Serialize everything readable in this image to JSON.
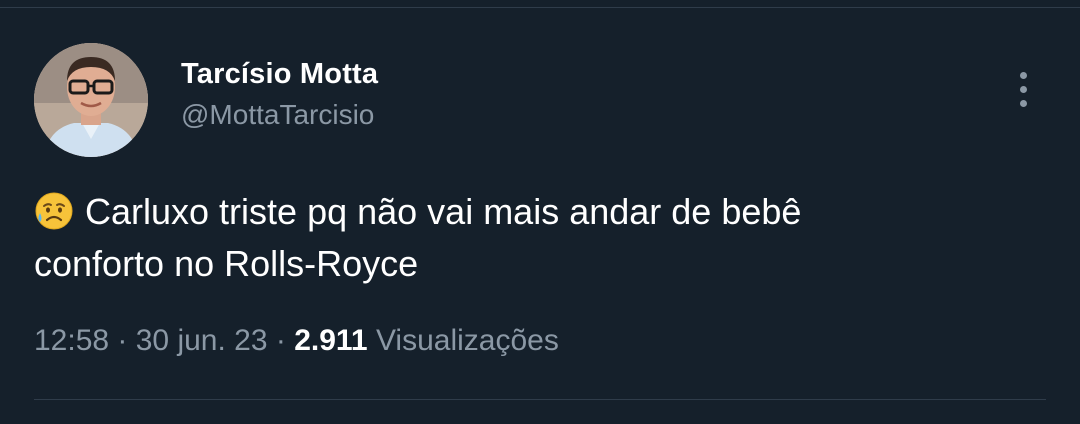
{
  "author": {
    "display_name": "Tarcísio Motta",
    "handle": "@MottaTarcisio",
    "avatar_icon": "profile-photo"
  },
  "menu": {
    "icon": "more-vertical-icon"
  },
  "tweet": {
    "emoji": "sad-relieved-face-emoji",
    "text_line_1": "Carluxo triste pq não vai mais andar de bebê",
    "text_line_2": "conforto no Rolls-Royce"
  },
  "meta": {
    "time": "12:58",
    "separator": " · ",
    "date": "30 jun. 23",
    "views_count": "2.911",
    "views_label": "Visualizações"
  },
  "colors": {
    "background": "#15202b",
    "primary_text": "#ffffff",
    "secondary_text": "#8b98a5",
    "divider": "#2f3c4a"
  }
}
